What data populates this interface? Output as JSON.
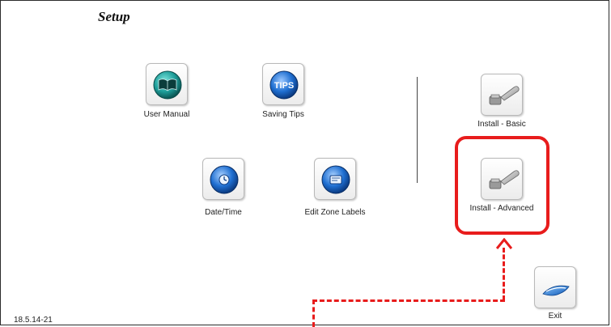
{
  "header": {
    "title": "Setup"
  },
  "buttons": {
    "user_manual": {
      "label": "User Manual",
      "icon": "book-icon"
    },
    "saving_tips": {
      "label": "Saving Tips",
      "icon": "tips-icon",
      "icon_text": "TIPS"
    },
    "date_time": {
      "label": "Date/Time",
      "icon": "clock-icon"
    },
    "edit_zone_labels": {
      "label": "Edit Zone Labels",
      "icon": "zone-label-icon"
    },
    "install_basic": {
      "label": "Install - Basic",
      "icon": "wrench-icon"
    },
    "install_advanced": {
      "label": "Install - Advanced",
      "icon": "wrench-icon"
    },
    "exit": {
      "label": "Exit",
      "icon": "exit-icon"
    }
  },
  "footer": {
    "version": "18.5.14-21"
  },
  "colors": {
    "highlight": "#e81c1c",
    "teal_icon": "#1e9e9a",
    "blue_icon": "#1f6fd1"
  }
}
